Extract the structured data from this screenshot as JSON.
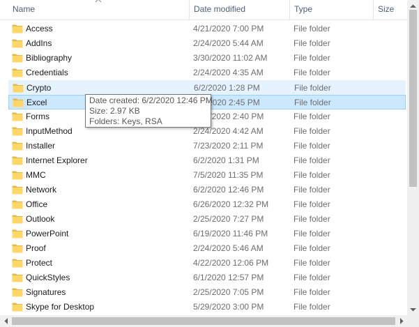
{
  "columns": {
    "name": "Name",
    "date_modified": "Date modified",
    "type": "Type",
    "size": "Size"
  },
  "rows": [
    {
      "name": "Access",
      "date": "4/21/2020 7:00 PM",
      "type": "File folder"
    },
    {
      "name": "AddIns",
      "date": "2/24/2020 5:44 AM",
      "type": "File folder"
    },
    {
      "name": "Bibliography",
      "date": "3/30/2020 11:02 AM",
      "type": "File folder"
    },
    {
      "name": "Credentials",
      "date": "2/24/2020 4:35 AM",
      "type": "File folder"
    },
    {
      "name": "Crypto",
      "date": "6/2/2020 1:28 PM",
      "type": "File folder"
    },
    {
      "name": "Excel",
      "date": "6/2/2020 2:45 PM",
      "type": "File folder"
    },
    {
      "name": "Forms",
      "date": "2/24/2020 2:40 PM",
      "type": "File folder"
    },
    {
      "name": "InputMethod",
      "date": "2/24/2020 4:42 AM",
      "type": "File folder"
    },
    {
      "name": "Installer",
      "date": "7/23/2020 2:11 PM",
      "type": "File folder"
    },
    {
      "name": "Internet Explorer",
      "date": "6/2/2020 1:31 PM",
      "type": "File folder"
    },
    {
      "name": "MMC",
      "date": "7/5/2020 11:35 PM",
      "type": "File folder"
    },
    {
      "name": "Network",
      "date": "6/2/2020 12:46 PM",
      "type": "File folder"
    },
    {
      "name": "Office",
      "date": "6/26/2020 12:32 PM",
      "type": "File folder"
    },
    {
      "name": "Outlook",
      "date": "2/25/2020 7:27 PM",
      "type": "File folder"
    },
    {
      "name": "PowerPoint",
      "date": "6/19/2020 11:46 PM",
      "type": "File folder"
    },
    {
      "name": "Proof",
      "date": "2/24/2020 5:46 AM",
      "type": "File folder"
    },
    {
      "name": "Protect",
      "date": "4/22/2020 12:06 PM",
      "type": "File folder"
    },
    {
      "name": "QuickStyles",
      "date": "6/1/2020 12:57 PM",
      "type": "File folder"
    },
    {
      "name": "Signatures",
      "date": "2/25/2020 7:05 PM",
      "type": "File folder"
    },
    {
      "name": "Skype for Desktop",
      "date": "5/29/2020 3:00 PM",
      "type": "File folder"
    }
  ],
  "hovered_row": "Crypto",
  "selected_row": "Excel",
  "tooltip": {
    "date_created": "Date created: 6/2/2020 12:46 PM",
    "size": "Size: 2.97 KB",
    "folders": "Folders: Keys, RSA"
  },
  "colors": {
    "header_text": "#4c607a",
    "hover_bg": "#e5f3ff",
    "selected_bg": "#cce8ff",
    "selected_border": "#99d1ff",
    "folder": "#ffd766"
  }
}
